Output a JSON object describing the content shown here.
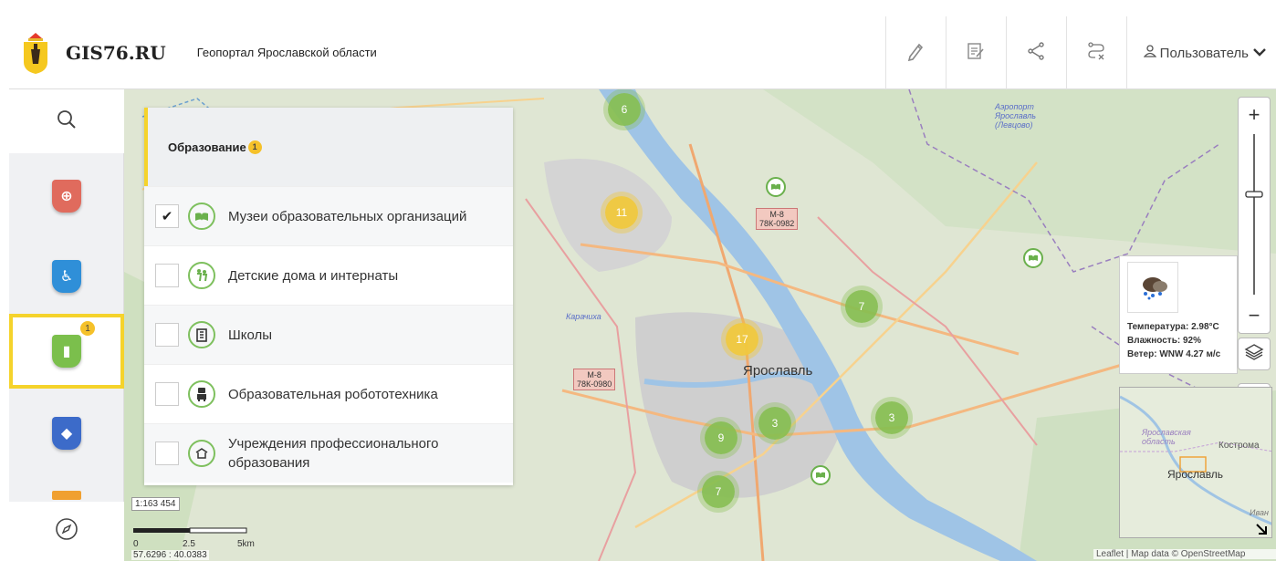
{
  "header": {
    "brand": "GIS76.RU",
    "subtitle": "Геопортал Ярославской области",
    "user_label": "Пользователь",
    "actions": [
      "pencil-icon",
      "notes-icon",
      "share-icon",
      "route-clear-icon"
    ]
  },
  "rail": {
    "active_badge": "1",
    "items": [
      {
        "icon": "health-icon",
        "color": "#e06b5d"
      },
      {
        "icon": "accessibility-icon",
        "color": "#2f8fd8"
      },
      {
        "icon": "education-icon",
        "color": "#7bbf4c"
      },
      {
        "icon": "security-icon",
        "color": "#3c6bc9"
      },
      {
        "icon": "more-icon",
        "color": "#f0a030"
      }
    ]
  },
  "panel": {
    "title": "Образование",
    "count": "1",
    "layers": [
      {
        "label": "Музеи образовательных организаций",
        "checked": true,
        "check_mark": "✔"
      },
      {
        "label": "Детские дома и интернаты",
        "checked": false,
        "check_mark": ""
      },
      {
        "label": "Школы",
        "checked": false,
        "check_mark": ""
      },
      {
        "label": "Образовательная робототехника",
        "checked": false,
        "check_mark": ""
      },
      {
        "label": "Учреждения профессионального образования",
        "checked": false,
        "check_mark": ""
      }
    ]
  },
  "map": {
    "clusters": [
      {
        "count": "6",
        "color": "green"
      },
      {
        "count": "11",
        "color": "yellow"
      },
      {
        "count": "17",
        "color": "yellow"
      },
      {
        "count": "7",
        "color": "green"
      },
      {
        "count": "3",
        "color": "green"
      },
      {
        "count": "9",
        "color": "green"
      },
      {
        "count": "3",
        "color": "green"
      },
      {
        "count": "7",
        "color": "green"
      }
    ],
    "road_labels": [
      {
        "line1": "М-8",
        "line2": "78К-0982"
      },
      {
        "line1": "М-8",
        "line2": "78К-0980"
      }
    ],
    "city": "Ярославль",
    "place_korochikha": "Карачиха",
    "airport_line1": "Аэропорт",
    "airport_line2": "Ярославль",
    "airport_line3": "(Левцово)",
    "scale_ratio": "1:163 454",
    "scale_ticks": [
      "0",
      "2.5",
      "5km"
    ],
    "coords": "57.6296 : 40.0383",
    "attribution": "Leaflet | Map data © OpenStreetMap"
  },
  "zoom": {
    "plus": "+",
    "minus": "−"
  },
  "weather": {
    "temperature": "Температура: 2.98°C",
    "humidity": "Влажность: 92%",
    "wind": "Ветер: WNW 4.27 м/с"
  },
  "minimap": {
    "region": "Ярославская",
    "region2": "область",
    "city": "Ярославль",
    "kostroma": "Кострома",
    "ivan": "Иван"
  }
}
